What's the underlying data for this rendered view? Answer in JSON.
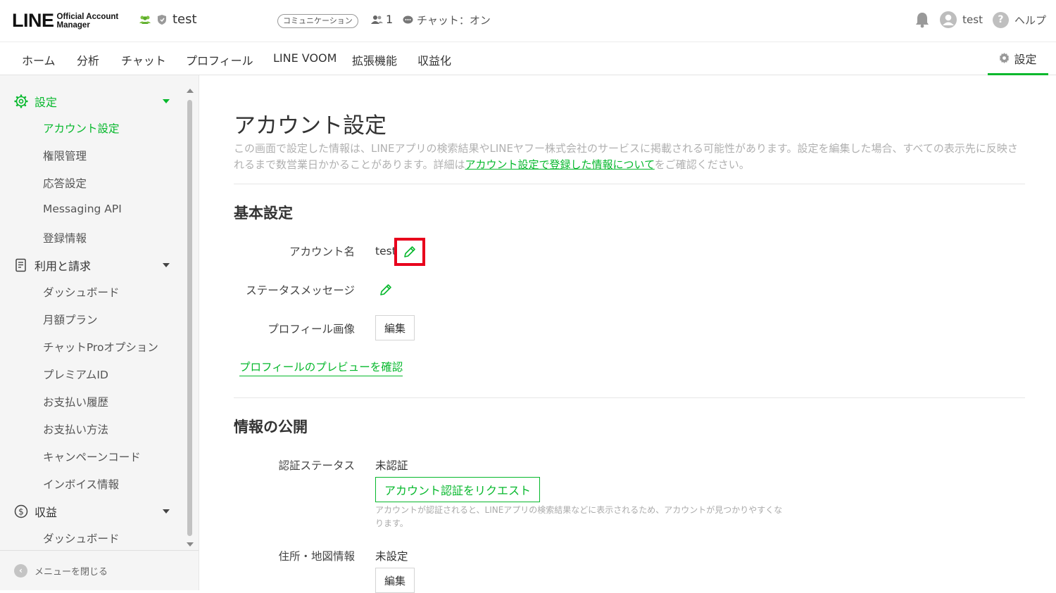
{
  "header": {
    "logo_main": "LINE",
    "logo_sub_1": "Official Account",
    "logo_sub_2": "Manager",
    "account_name": "test",
    "plan_badge": "コミュニケーション",
    "friends_count": "1",
    "chat_status": "チャット：オン",
    "user_name": "test",
    "help_label": "ヘルプ"
  },
  "nav": {
    "tabs": [
      "ホーム",
      "分析",
      "チャット",
      "プロフィール",
      "LINE VOOM",
      "拡張機能",
      "収益化"
    ],
    "settings_label": "設定"
  },
  "sidebar": {
    "group_settings": "設定",
    "settings_items": [
      "アカウント設定",
      "権限管理",
      "応答設定",
      "Messaging API",
      "登録情報"
    ],
    "group_billing": "利用と請求",
    "billing_items": [
      "ダッシュボード",
      "月額プラン",
      "チャットProオプション",
      "プレミアムID",
      "お支払い履歴",
      "お支払い方法",
      "キャンペーンコード",
      "インボイス情報"
    ],
    "group_revenue": "収益",
    "revenue_items": [
      "ダッシュボード"
    ],
    "close_menu": "メニューを閉じる"
  },
  "main": {
    "title": "アカウント設定",
    "intro_text_1": "この画面で設定した情報は、LINEアプリの検索結果やLINEヤフー株式会社のサービスに掲載される可能性があります。設定を編集した場合、すべての表示先に反映されるまで数営業日かかることがあります。詳細は",
    "intro_link": "アカウント設定で登録した情報について",
    "intro_text_2": "をご確認ください。",
    "basic_title": "基本設定",
    "account_name_label": "アカウント名",
    "account_name_value": "test",
    "status_label": "ステータスメッセージ",
    "profile_image_label": "プロフィール画像",
    "edit_label": "編集",
    "preview_link": "プロフィールのプレビューを確認",
    "public_title": "情報の公開",
    "verify_label": "認証ステータス",
    "verify_value": "未認証",
    "verify_button": "アカウント認証をリクエスト",
    "verify_hint": "アカウントが認証されると、LINEアプリの検索結果などに表示されるため、アカウントが見つかりやすくなります。",
    "address_label": "住所・地図情報",
    "address_value": "未設定",
    "address_edit": "編集"
  },
  "colors": {
    "brand_green": "#06b82c",
    "highlight_red": "#e8001c"
  }
}
